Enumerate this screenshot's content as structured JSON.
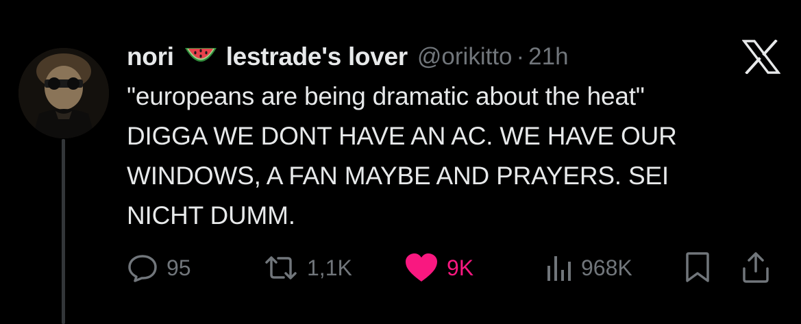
{
  "tweet": {
    "display_name": "nori",
    "display_name_suffix": "lestrade's lover",
    "name_emoji": "watermelon-emoji",
    "handle": "@orikitto",
    "separator": "·",
    "time": "21h",
    "body": "\"europeans are being dramatic about the heat\"\nDIGGA WE DONT HAVE AN AC. WE HAVE OUR\nWINDOWS, A FAN MAYBE AND PRAYERS. SEI\nNICHT DUMM.",
    "platform_icon": "x-logo-icon"
  },
  "actions": {
    "reply_count": "95",
    "repost_count": "1,1K",
    "like_count": "9K",
    "views_count": "968K"
  },
  "colors": {
    "background": "#000000",
    "text_primary": "#e7e9ea",
    "text_secondary": "#71767b",
    "like_active": "#f91880",
    "thread_line": "#333639"
  }
}
